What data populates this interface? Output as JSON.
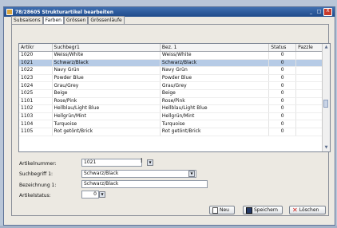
{
  "window": {
    "title": "78/28605 Strukturartikel bearbeiten",
    "controls": {
      "minimize": "_",
      "maximize": "□",
      "close": "X"
    }
  },
  "tabs": [
    {
      "label": "Subsaisons"
    },
    {
      "label": "Farben"
    },
    {
      "label": "Grössen"
    },
    {
      "label": "Grössenläufe"
    }
  ],
  "grid": {
    "columns": [
      "Artikr",
      "Suchbegr1",
      "Bez. 1",
      "Status",
      "Pazzle"
    ],
    "rows": [
      [
        "1020",
        "Weiss/White",
        "Weiss/White",
        "0"
      ],
      [
        "1021",
        "Schwarz/Black",
        "Schwarz/Black",
        "0"
      ],
      [
        "1022",
        "Navy Grün",
        "Navy Grün",
        "0"
      ],
      [
        "1023",
        "Powder Blue",
        "Powder Blue",
        "0"
      ],
      [
        "1024",
        "Grau/Grey",
        "Grau/Grey",
        "0"
      ],
      [
        "1025",
        "Beige",
        "Beige",
        "0"
      ],
      [
        "1101",
        "Rose/Pink",
        "Rose/Pink",
        "0"
      ],
      [
        "1102",
        "Hellblau/Light Blue",
        "Hellblau/Light Blue",
        "0"
      ],
      [
        "1103",
        "Hellgrün/Mint",
        "Hellgrün/Mint",
        "0"
      ],
      [
        "1104",
        "Turquoise",
        "Turquoise",
        "0"
      ],
      [
        "1105",
        "Rot getönt/Brick",
        "Rot getönt/Brick",
        "0"
      ]
    ],
    "selected_row": 1
  },
  "form": {
    "artikelnummer_label": "Artikelnummer:",
    "artikelnummer_value": "1021",
    "suchbegriff_label": "Suchbegriff 1:",
    "suchbegriff_value": "Schwarz/Black",
    "bezeichnung_label": "Bezeichnung 1:",
    "bezeichnung_value": "Schwarz/Black",
    "artikelstatus_label": "Artikelstatus:",
    "artikelstatus_value": "0"
  },
  "buttons": {
    "new": "Neu",
    "save": "Speichern",
    "delete": "Löschen"
  },
  "colors": {
    "titlebar": "#1f4a8a",
    "selection": "#b6cbe6",
    "delete_icon": "#d0201a"
  }
}
